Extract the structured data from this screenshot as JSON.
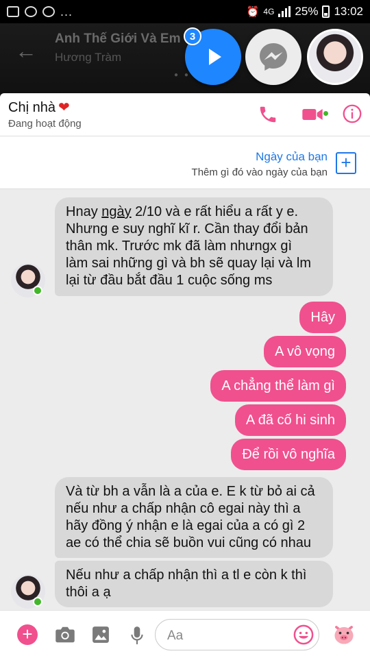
{
  "status_bar": {
    "notifications": "...",
    "network": "4G",
    "battery": "25%",
    "time": "13:02"
  },
  "music_header": {
    "song_title": "Anh Thế Giới Và Em",
    "artist": "Hương Tràm",
    "badge_count": "3"
  },
  "chat_header": {
    "contact_name": "Chị nhà",
    "heart": "❤",
    "status": "Đang hoạt động"
  },
  "day_banner": {
    "title": "Ngày của bạn",
    "subtitle": "Thêm gì đó vào ngày của bạn",
    "add_label": "+"
  },
  "messages": [
    {
      "from": "them",
      "lines": [
        "Hnay ngày 2/10 và e rất hiểu a rất y e.",
        "Nhưng e suy nghĩ kĩ r. Cần thay đổi bản",
        "thân mk. Trước mk đã làm nhưngx gì",
        "làm sai những gì và bh sẽ quay lại và lm",
        "lại từ đầu bắt đầu 1 cuộc sống ms"
      ]
    },
    {
      "from": "me",
      "text": "Hây"
    },
    {
      "from": "me",
      "text": "A vô vọng"
    },
    {
      "from": "me",
      "text": "A chẳng thể làm gì"
    },
    {
      "from": "me",
      "text": "A đã cố hi sinh"
    },
    {
      "from": "me",
      "text": "Để rồi vô nghĩa"
    },
    {
      "from": "them",
      "lines": [
        "Và từ bh a vẫn là a của e. E k từ bỏ ai cả",
        "nếu như a chấp nhận cô egai này thì a",
        "hãy đồng ý nhận e là egai của a có gì 2",
        "ae có thể chia sẽ buồn vui cũng có nhau"
      ]
    },
    {
      "from": "them",
      "lines": [
        "Nếu như a chấp nhận thì a tl e còn k thì",
        "thôi a ạ"
      ]
    }
  ],
  "composer": {
    "placeholder": "Aa"
  },
  "colors": {
    "accent_pink": "#f0508e",
    "link_blue": "#1e78e6",
    "online_green": "#42b72a",
    "incoming_bubble": "#d8d8d8"
  },
  "icons": [
    "back-arrow-icon",
    "play-icon",
    "messenger-icon",
    "phone-icon",
    "video-camera-icon",
    "info-icon",
    "plus-icon",
    "camera-icon",
    "image-icon",
    "microphone-icon",
    "emoji-icon",
    "pig-sticker-icon"
  ]
}
